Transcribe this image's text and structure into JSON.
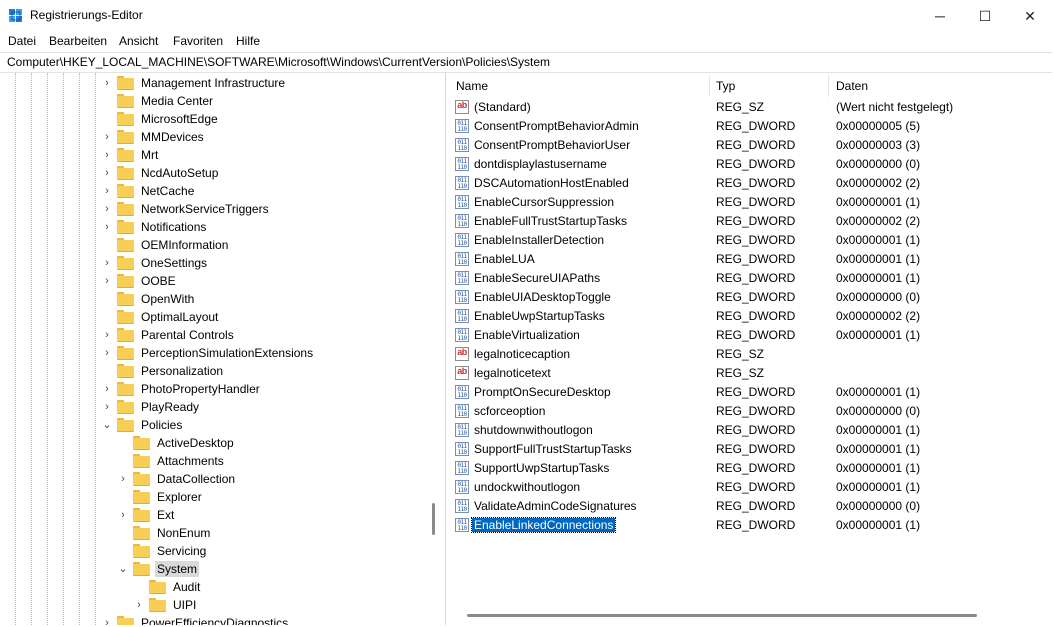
{
  "window": {
    "title": "Registrierungs-Editor",
    "minimize": "─",
    "maximize": "☐",
    "close": "✕"
  },
  "menu": [
    {
      "label": "Datei"
    },
    {
      "label": "Bearbeiten"
    },
    {
      "label": "Ansicht"
    },
    {
      "label": "Favoriten"
    },
    {
      "label": "Hilfe"
    }
  ],
  "address": "Computer\\HKEY_LOCAL_MACHINE\\SOFTWARE\\Microsoft\\Windows\\CurrentVersion\\Policies\\System",
  "tree": [
    {
      "label": "Management Infrastructure",
      "level": 0,
      "expander": "collapsed"
    },
    {
      "label": "Media Center",
      "level": 0,
      "expander": "none"
    },
    {
      "label": "MicrosoftEdge",
      "level": 0,
      "expander": "none"
    },
    {
      "label": "MMDevices",
      "level": 0,
      "expander": "collapsed"
    },
    {
      "label": "Mrt",
      "level": 0,
      "expander": "collapsed"
    },
    {
      "label": "NcdAutoSetup",
      "level": 0,
      "expander": "collapsed"
    },
    {
      "label": "NetCache",
      "level": 0,
      "expander": "collapsed"
    },
    {
      "label": "NetworkServiceTriggers",
      "level": 0,
      "expander": "collapsed"
    },
    {
      "label": "Notifications",
      "level": 0,
      "expander": "collapsed"
    },
    {
      "label": "OEMInformation",
      "level": 0,
      "expander": "none"
    },
    {
      "label": "OneSettings",
      "level": 0,
      "expander": "collapsed"
    },
    {
      "label": "OOBE",
      "level": 0,
      "expander": "collapsed"
    },
    {
      "label": "OpenWith",
      "level": 0,
      "expander": "none"
    },
    {
      "label": "OptimalLayout",
      "level": 0,
      "expander": "none"
    },
    {
      "label": "Parental Controls",
      "level": 0,
      "expander": "collapsed"
    },
    {
      "label": "PerceptionSimulationExtensions",
      "level": 0,
      "expander": "collapsed"
    },
    {
      "label": "Personalization",
      "level": 0,
      "expander": "none"
    },
    {
      "label": "PhotoPropertyHandler",
      "level": 0,
      "expander": "collapsed"
    },
    {
      "label": "PlayReady",
      "level": 0,
      "expander": "collapsed"
    },
    {
      "label": "Policies",
      "level": 0,
      "expander": "expanded"
    },
    {
      "label": "ActiveDesktop",
      "level": 1,
      "expander": "none"
    },
    {
      "label": "Attachments",
      "level": 1,
      "expander": "none"
    },
    {
      "label": "DataCollection",
      "level": 1,
      "expander": "collapsed"
    },
    {
      "label": "Explorer",
      "level": 1,
      "expander": "none"
    },
    {
      "label": "Ext",
      "level": 1,
      "expander": "collapsed"
    },
    {
      "label": "NonEnum",
      "level": 1,
      "expander": "none"
    },
    {
      "label": "Servicing",
      "level": 1,
      "expander": "none"
    },
    {
      "label": "System",
      "level": 1,
      "expander": "expanded",
      "selected": true
    },
    {
      "label": "Audit",
      "level": 2,
      "expander": "none"
    },
    {
      "label": "UIPI",
      "level": 2,
      "expander": "collapsed"
    },
    {
      "label": "PowerEfficiencyDiagnostics",
      "level": 0,
      "expander": "collapsed"
    }
  ],
  "columns": {
    "name": "Name",
    "type": "Typ",
    "data": "Daten"
  },
  "values": [
    {
      "name": "(Standard)",
      "type": "REG_SZ",
      "data": "(Wert nicht festgelegt)",
      "icon": "string-value-icon"
    },
    {
      "name": "ConsentPromptBehaviorAdmin",
      "type": "REG_DWORD",
      "data": "0x00000005 (5)",
      "icon": "dword-value-icon"
    },
    {
      "name": "ConsentPromptBehaviorUser",
      "type": "REG_DWORD",
      "data": "0x00000003 (3)",
      "icon": "dword-value-icon"
    },
    {
      "name": "dontdisplaylastusername",
      "type": "REG_DWORD",
      "data": "0x00000000 (0)",
      "icon": "dword-value-icon"
    },
    {
      "name": "DSCAutomationHostEnabled",
      "type": "REG_DWORD",
      "data": "0x00000002 (2)",
      "icon": "dword-value-icon"
    },
    {
      "name": "EnableCursorSuppression",
      "type": "REG_DWORD",
      "data": "0x00000001 (1)",
      "icon": "dword-value-icon"
    },
    {
      "name": "EnableFullTrustStartupTasks",
      "type": "REG_DWORD",
      "data": "0x00000002 (2)",
      "icon": "dword-value-icon"
    },
    {
      "name": "EnableInstallerDetection",
      "type": "REG_DWORD",
      "data": "0x00000001 (1)",
      "icon": "dword-value-icon"
    },
    {
      "name": "EnableLUA",
      "type": "REG_DWORD",
      "data": "0x00000001 (1)",
      "icon": "dword-value-icon"
    },
    {
      "name": "EnableSecureUIAPaths",
      "type": "REG_DWORD",
      "data": "0x00000001 (1)",
      "icon": "dword-value-icon"
    },
    {
      "name": "EnableUIADesktopToggle",
      "type": "REG_DWORD",
      "data": "0x00000000 (0)",
      "icon": "dword-value-icon"
    },
    {
      "name": "EnableUwpStartupTasks",
      "type": "REG_DWORD",
      "data": "0x00000002 (2)",
      "icon": "dword-value-icon"
    },
    {
      "name": "EnableVirtualization",
      "type": "REG_DWORD",
      "data": "0x00000001 (1)",
      "icon": "dword-value-icon"
    },
    {
      "name": "legalnoticecaption",
      "type": "REG_SZ",
      "data": "",
      "icon": "string-value-icon"
    },
    {
      "name": "legalnoticetext",
      "type": "REG_SZ",
      "data": "",
      "icon": "string-value-icon"
    },
    {
      "name": "PromptOnSecureDesktop",
      "type": "REG_DWORD",
      "data": "0x00000001 (1)",
      "icon": "dword-value-icon"
    },
    {
      "name": "scforceoption",
      "type": "REG_DWORD",
      "data": "0x00000000 (0)",
      "icon": "dword-value-icon"
    },
    {
      "name": "shutdownwithoutlogon",
      "type": "REG_DWORD",
      "data": "0x00000001 (1)",
      "icon": "dword-value-icon"
    },
    {
      "name": "SupportFullTrustStartupTasks",
      "type": "REG_DWORD",
      "data": "0x00000001 (1)",
      "icon": "dword-value-icon"
    },
    {
      "name": "SupportUwpStartupTasks",
      "type": "REG_DWORD",
      "data": "0x00000001 (1)",
      "icon": "dword-value-icon"
    },
    {
      "name": "undockwithoutlogon",
      "type": "REG_DWORD",
      "data": "0x00000001 (1)",
      "icon": "dword-value-icon"
    },
    {
      "name": "ValidateAdminCodeSignatures",
      "type": "REG_DWORD",
      "data": "0x00000000 (0)",
      "icon": "dword-value-icon"
    },
    {
      "name": "EnableLinkedConnections",
      "type": "REG_DWORD",
      "data": "0x00000001 (1)",
      "icon": "dword-value-icon",
      "selected": true
    }
  ],
  "icons": {
    "string_glyph": "ab",
    "dword_glyph": "011\n110",
    "chevron_collapsed": "›",
    "chevron_expanded": "⌄"
  },
  "colors": {
    "selection": "#0067c0",
    "folder": "#f8cf56",
    "tree_selection": "#d9d9d9"
  }
}
